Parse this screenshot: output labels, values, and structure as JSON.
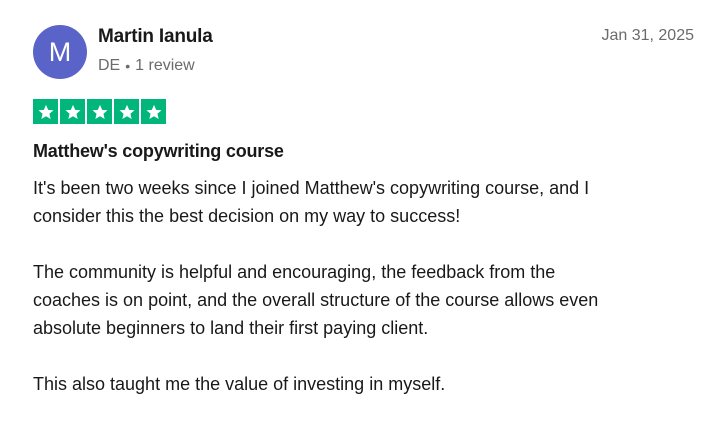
{
  "reviewer": {
    "initial": "M",
    "name": "Martin Ianula",
    "country": "DE",
    "review_count": "1 review",
    "avatar_color": "#5a64c8"
  },
  "review": {
    "date": "Jan 31, 2025",
    "rating": 5,
    "star_color": "#00b67a",
    "title": "Matthew's copywriting course",
    "paragraphs": [
      "It's been two weeks since I joined Matthew's copywriting course, and I\nconsider this the best decision on my way to success!",
      "The community is helpful and encouraging, the feedback from the\ncoaches is on point, and the overall structure of the course allows even\nabsolute beginners to land their first paying client.",
      "This also taught me the value of investing in myself."
    ]
  },
  "icons": {
    "star": "star-icon"
  }
}
